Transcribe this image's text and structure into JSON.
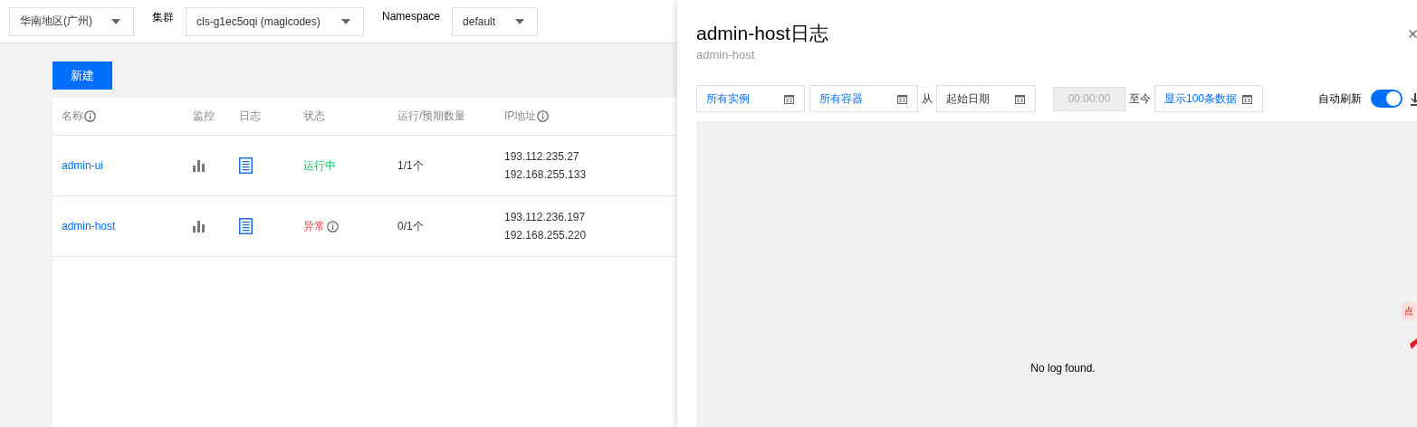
{
  "top_bar": {
    "region": {
      "value": "华南地区(广州)"
    },
    "cluster_label": "集群",
    "cluster": {
      "value": "cls-g1ec5oqi (magicodes)"
    },
    "namespace_label": "Namespace",
    "namespace": {
      "value": "default"
    }
  },
  "create_button": "新建",
  "table": {
    "columns": [
      {
        "label": "名称",
        "info": true
      },
      {
        "label": "监控",
        "info": false
      },
      {
        "label": "日志",
        "info": false
      },
      {
        "label": "状态",
        "info": false
      },
      {
        "label": "运行/预期数量",
        "info": false
      },
      {
        "label": "IP地址",
        "info": true
      }
    ],
    "rows": [
      {
        "name": "admin-ui",
        "status": {
          "text": "运行中",
          "kind": "running",
          "info": false
        },
        "count": "1/1个",
        "ips": [
          "193.112.235.27",
          "192.168.255.133"
        ]
      },
      {
        "name": "admin-host",
        "status": {
          "text": "异常",
          "kind": "error",
          "info": true
        },
        "count": "0/1个",
        "ips": [
          "193.112.236.197",
          "192.168.255.220"
        ]
      }
    ]
  },
  "drawer": {
    "title": "admin-host日志",
    "subtitle": "admin-host",
    "toolbar": [
      {
        "kind": "select",
        "value": "所有实例"
      },
      {
        "kind": "select",
        "value": "所有容器"
      },
      {
        "kind": "label",
        "text": "从"
      },
      {
        "kind": "date",
        "value": "起始日期"
      },
      {
        "kind": "time",
        "value": "00:00:00",
        "disabled": true
      },
      {
        "kind": "label",
        "text": "至今"
      },
      {
        "kind": "select",
        "value": "显示100条数据"
      }
    ],
    "auto_refresh": {
      "label": "自动刷新",
      "on": true
    },
    "empty_message": "No log found.",
    "badge": "点"
  }
}
